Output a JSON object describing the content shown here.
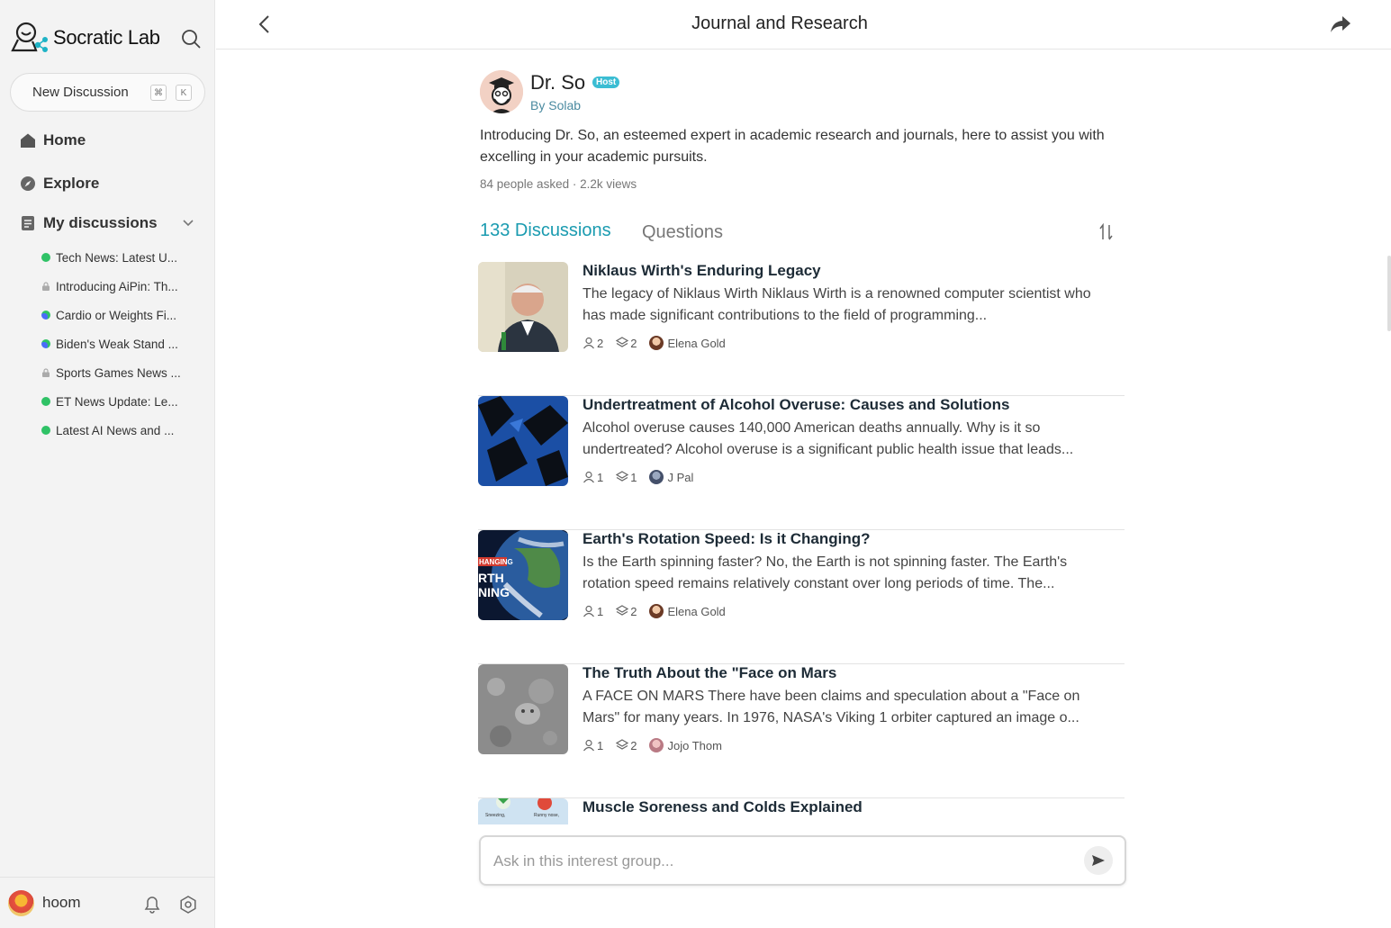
{
  "sidebar": {
    "logo_text": "Socratic Lab",
    "new_discussion": "New Discussion",
    "shortcut_cmd": "⌘",
    "shortcut_key": "K",
    "nav": {
      "home": "Home",
      "explore": "Explore",
      "my_discussions": "My discussions"
    },
    "discussions": [
      {
        "label": "Tech News: Latest U...",
        "status": "green"
      },
      {
        "label": "Introducing AiPin: Th...",
        "status": "lock"
      },
      {
        "label": "Cardio or Weights Fi...",
        "status": "multi"
      },
      {
        "label": "Biden's Weak Stand ...",
        "status": "multi"
      },
      {
        "label": "Sports Games News ...",
        "status": "lock"
      },
      {
        "label": "ET News Update: Le...",
        "status": "green"
      },
      {
        "label": "Latest AI News and ...",
        "status": "green"
      }
    ],
    "user": {
      "name": "hoom"
    }
  },
  "header": {
    "title": "Journal and Research"
  },
  "host": {
    "name": "Dr. So",
    "badge": "Host",
    "by": "By Solab",
    "description": "Introducing Dr. So, an esteemed expert in academic research and journals, here to assist you with excelling in your academic pursuits.",
    "stats": "84 people asked · 2.2k views"
  },
  "tabs": {
    "discussions": "133 Discussions",
    "questions": "Questions"
  },
  "cards": [
    {
      "title": "Niklaus Wirth's Enduring Legacy",
      "text": "The legacy of Niklaus Wirth Niklaus Wirth is a renowned computer scientist who has made significant contributions to the field of programming...",
      "people": "2",
      "layers": "2",
      "author": "Elena Gold"
    },
    {
      "title": "Undertreatment of Alcohol Overuse: Causes and Solutions",
      "text": "Alcohol overuse causes 140,000 American deaths annually. Why is it so undertreated? Alcohol overuse is a significant public health issue that leads...",
      "people": "1",
      "layers": "1",
      "author": "J Pal"
    },
    {
      "title": "Earth's Rotation Speed: Is it Changing?",
      "text": "Is the Earth spinning faster? No, the Earth is not spinning faster. The Earth's rotation speed remains relatively constant over long periods of time. The...",
      "people": "1",
      "layers": "2",
      "author": "Elena Gold"
    },
    {
      "title": "The Truth About the \"Face on Mars",
      "text": "A FACE ON MARS There have been claims and speculation about a \"Face on Mars\" for many years. In 1976, NASA's Viking 1 orbiter captured an image o...",
      "people": "1",
      "layers": "2",
      "author": "Jojo Thom"
    },
    {
      "title": "Muscle Soreness and Colds Explained"
    }
  ],
  "thumb_text": {
    "earth_1": "HANGING",
    "earth_2": "RTH",
    "earth_3": "NING",
    "muscle_1": "Sneezing,",
    "muscle_2": "Runny nose,"
  },
  "composer": {
    "placeholder": "Ask in this interest group..."
  }
}
